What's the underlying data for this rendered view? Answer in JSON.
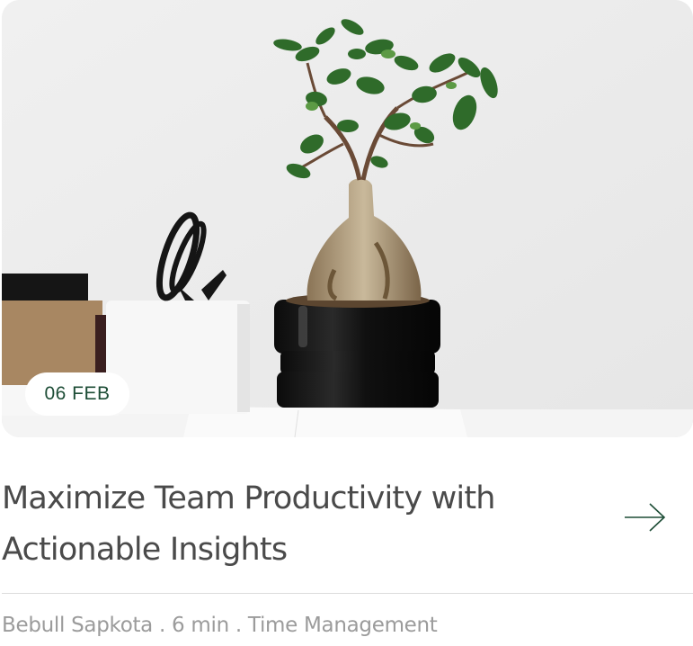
{
  "card": {
    "date_badge": "06 FEB",
    "title": "Maximize Team Productivity with Actionable Insights",
    "meta": {
      "author": "Bebull Sapkota",
      "separator": " . ",
      "read_time": "6 min",
      "category": "Time Management"
    },
    "arrow_icon": "arrow-right-icon",
    "image_subject": "bonsai-plant-on-desk"
  },
  "colors": {
    "badge_text": "#1d4d36",
    "title_text": "#4a4a4a",
    "meta_text": "#9b9b9b",
    "divider": "#dcdcdc",
    "arrow": "#1d4d36"
  }
}
